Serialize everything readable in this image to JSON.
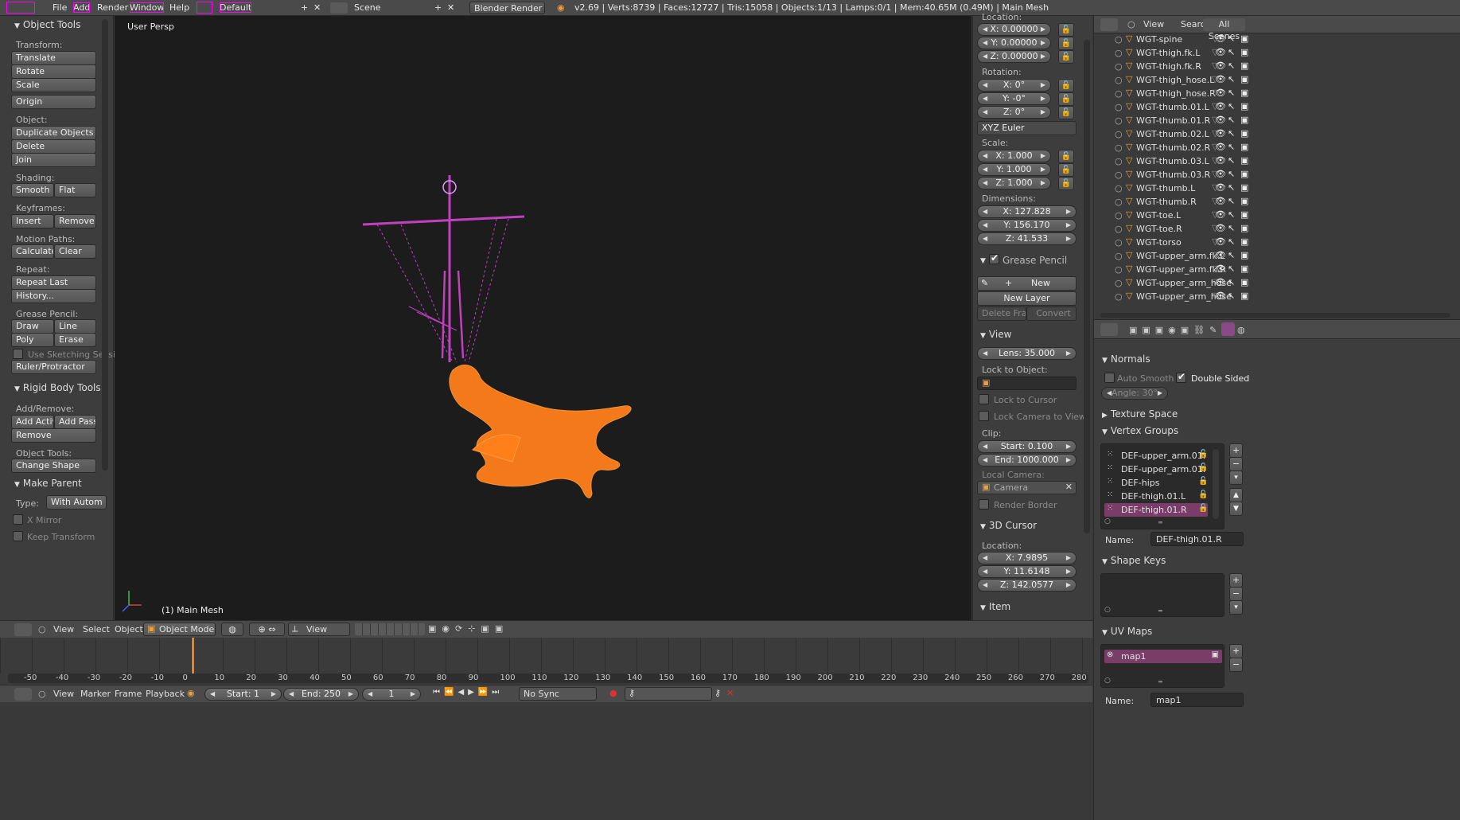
{
  "topbar": {
    "menus": [
      "File",
      "Add",
      "Render",
      "Window",
      "Help"
    ],
    "layout": "Default",
    "scene": "Scene",
    "engine": "Blender Render",
    "stats": "v2.69 | Verts:8739 | Faces:12727 | Tris:15058 | Objects:1/13 | Lamps:0/1 | Mem:40.65M (0.49M) | Main Mesh"
  },
  "toolshelf": {
    "title": "Object Tools",
    "transform_label": "Transform:",
    "translate": "Translate",
    "rotate": "Rotate",
    "scale": "Scale",
    "origin": "Origin",
    "object_label": "Object:",
    "duplicate": "Duplicate Objects",
    "delete": "Delete",
    "join": "Join",
    "shading_label": "Shading:",
    "smooth": "Smooth",
    "flat": "Flat",
    "keyframes_label": "Keyframes:",
    "insert": "Insert",
    "remove": "Remove",
    "motion_label": "Motion Paths:",
    "calculate": "Calculate",
    "clear": "Clear",
    "repeat_label": "Repeat:",
    "repeat_last": "Repeat Last",
    "history": "History...",
    "gp_label": "Grease Pencil:",
    "draw": "Draw",
    "line": "Line",
    "poly": "Poly",
    "erase": "Erase",
    "sketch": "Use Sketching Sessi",
    "ruler": "Ruler/Protractor",
    "rigid_title": "Rigid Body Tools",
    "addremove_label": "Add/Remove:",
    "add_active": "Add Active",
    "add_passive": "Add Passiv",
    "rb_remove": "Remove",
    "objtools_label": "Object Tools:",
    "change_shape": "Change Shape",
    "make_parent": "Make Parent",
    "type_label": "Type:",
    "type_value": "With Autom",
    "x_mirror": "X Mirror",
    "keep_transform": "Keep Transform"
  },
  "viewport": {
    "view_name": "User Persp",
    "object_name": "(1) Main Mesh"
  },
  "properties_n": {
    "location_label": "Location:",
    "loc_x": "X: 0.00000",
    "loc_y": "Y: 0.00000",
    "loc_z": "Z: 0.00000",
    "rotation_label": "Rotation:",
    "rot_x": "X: 0°",
    "rot_y": "Y: -0°",
    "rot_z": "Z: 0°",
    "rot_mode": "XYZ Euler",
    "scale_label": "Scale:",
    "sc_x": "X: 1.000",
    "sc_y": "Y: 1.000",
    "sc_z": "Z: 1.000",
    "dimensions_label": "Dimensions:",
    "dim_x": "X: 127.828",
    "dim_y": "Y: 156.170",
    "dim_z": "Z: 41.533",
    "gp_title": "Grease Pencil",
    "gp_new": "New",
    "gp_new_layer": "New Layer",
    "gp_delete_frame": "Delete Frame",
    "gp_convert": "Convert",
    "view_title": "View",
    "lens": "Lens: 35.000",
    "lock_obj_label": "Lock to Object:",
    "lock_cursor": "Lock to Cursor",
    "lock_camera": "Lock Camera to View",
    "clip_label": "Clip:",
    "clip_start": "Start: 0.100",
    "clip_end": "End: 1000.000",
    "local_camera_label": "Local Camera:",
    "camera": "Camera",
    "render_border": "Render Border",
    "cursor_title": "3D Cursor",
    "cursor_loc_label": "Location:",
    "cur_x": "X: 7.9895",
    "cur_y": "Y: 11.6148",
    "cur_z": "Z: 142.0577",
    "item_title": "Item"
  },
  "outliner": {
    "view": "View",
    "search": "Search",
    "scenes": "All Scenes",
    "items": [
      "WGT-spine",
      "WGT-thigh.fk.L",
      "WGT-thigh.fk.R",
      "WGT-thigh_hose.L",
      "WGT-thigh_hose.R",
      "WGT-thumb.01.L",
      "WGT-thumb.01.R",
      "WGT-thumb.02.L",
      "WGT-thumb.02.R",
      "WGT-thumb.03.L",
      "WGT-thumb.03.R",
      "WGT-thumb.L",
      "WGT-thumb.R",
      "WGT-toe.L",
      "WGT-toe.R",
      "WGT-torso",
      "WGT-upper_arm.fk.L",
      "WGT-upper_arm.fk.R",
      "WGT-upper_arm_hose",
      "WGT-upper_arm_hose"
    ]
  },
  "data_props": {
    "normals": "Normals",
    "auto_smooth": "Auto Smooth",
    "double_sided": "Double Sided",
    "angle": "Angle: 30°",
    "texture_space": "Texture Space",
    "vertex_groups": "Vertex Groups",
    "groups": [
      "DEF-upper_arm.01.",
      "DEF-upper_arm.01.",
      "DEF-hips",
      "DEF-thigh.01.L",
      "DEF-thigh.01.R"
    ],
    "name_label": "Name:",
    "name_value": "DEF-thigh.01.R",
    "shape_keys": "Shape Keys",
    "uv_maps": "UV Maps",
    "uv_item": "map1",
    "uv_name_label": "Name:",
    "uv_name_value": "map1"
  },
  "viewport_header": {
    "view": "View",
    "select": "Select",
    "object": "Object",
    "mode": "Object Mode",
    "view2": "View"
  },
  "timeline": {
    "ticks": [
      "-50",
      "-40",
      "-30",
      "-20",
      "-10",
      "0",
      "10",
      "20",
      "30",
      "40",
      "50",
      "60",
      "70",
      "80",
      "90",
      "100",
      "110",
      "120",
      "130",
      "140",
      "150",
      "160",
      "170",
      "180",
      "190",
      "200",
      "210",
      "220",
      "230",
      "240",
      "250",
      "260",
      "270",
      "280"
    ],
    "view": "View",
    "marker": "Marker",
    "frame": "Frame",
    "playback": "Playback",
    "start": "Start: 1",
    "end": "End: 250",
    "current": "1",
    "sync": "No Sync"
  },
  "colors": {
    "mesh": "#ff7f1a",
    "armature": "#c040c0",
    "selected_row": "#7a3d6a"
  }
}
